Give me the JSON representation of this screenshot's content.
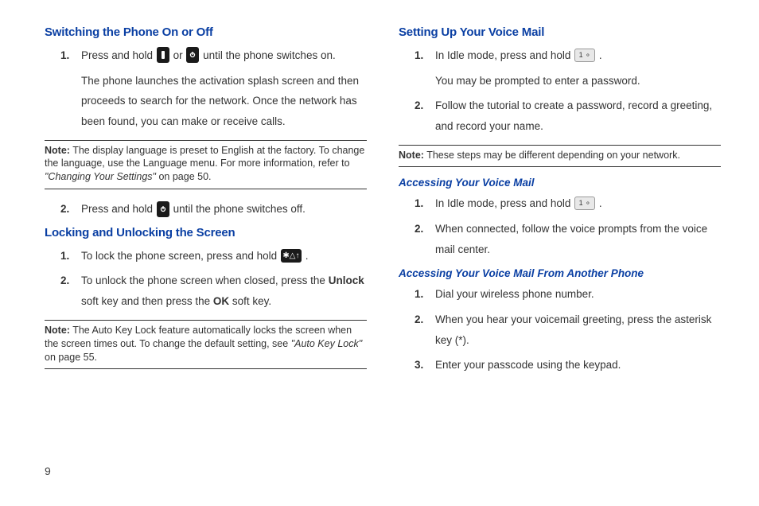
{
  "pageNumber": "9",
  "left": {
    "heading1": "Switching the Phone On or Off",
    "list1": {
      "item1_a": "Press and hold ",
      "item1_b": " or ",
      "item1_c": " until the phone switches on.",
      "item1_para": "The phone launches the activation splash screen and then proceeds to search for the network. Once the network has been found, you can make or receive calls.",
      "item2_a": "Press and hold ",
      "item2_b": " until the phone switches off."
    },
    "note1": {
      "label": "Note:",
      "text_a": " The display language is preset to English at the factory. To change the language, use the Language menu. For more information, refer to ",
      "ref": "\"Changing Your Settings\"",
      "text_b": "  on page 50."
    },
    "heading2": "Locking and Unlocking the Screen",
    "list2": {
      "item1_a": "To lock the phone screen, press and hold ",
      "item1_b": ".",
      "item2_a": "To unlock the phone screen when closed, press the ",
      "item2_unlock": "Unlock",
      "item2_b": " soft key and then press the ",
      "item2_ok": "OK",
      "item2_c": " soft key."
    },
    "note2": {
      "label": "Note:",
      "text_a": " The Auto Key Lock feature automatically locks the screen when the screen times out. To change the default setting, see ",
      "ref": "\"Auto Key Lock\"",
      "text_b": " on page 55."
    }
  },
  "right": {
    "heading1": "Setting Up Your Voice Mail",
    "list1": {
      "item1_a": "In Idle mode, press and hold ",
      "item1_b": ".",
      "item1_para": "You may be prompted to enter a password.",
      "item2": "Follow the tutorial to create a password, record a greeting, and record your name."
    },
    "note1": {
      "label": "Note:",
      "text": " These steps may be different depending on your network."
    },
    "sub1": "Accessing Your Voice Mail",
    "list2": {
      "item1_a": "In Idle mode, press and hold ",
      "item1_b": ".",
      "item2": "When connected, follow the voice prompts from the voice mail center."
    },
    "sub2": "Accessing Your Voice Mail From Another Phone",
    "list3": {
      "item1": "Dial your wireless phone number.",
      "item2": "When you hear your voicemail greeting, press the asterisk key (*).",
      "item3": "Enter your passcode using the keypad."
    }
  }
}
